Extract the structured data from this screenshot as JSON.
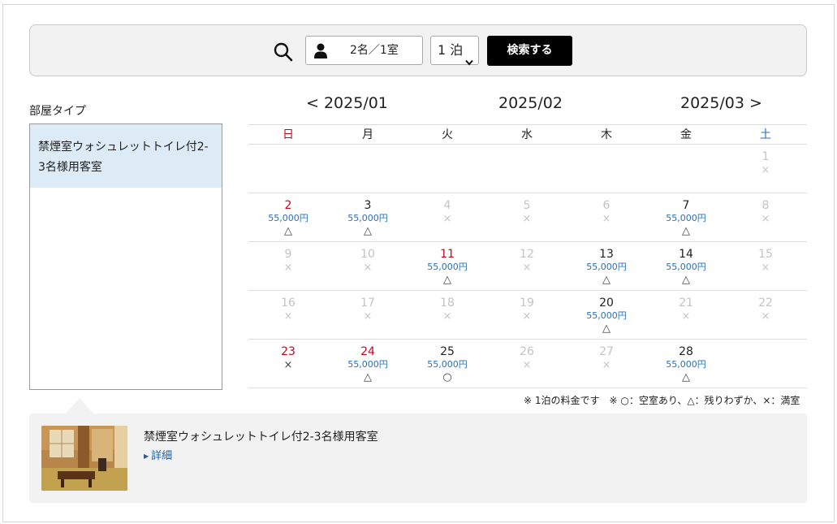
{
  "search": {
    "guests": "2名／1室",
    "nights": "1 泊",
    "button_label": "検索する"
  },
  "room_type": {
    "label": "部屋タイプ",
    "items": [
      {
        "name": "禁煙室ウォシュレットトイレ付2-3名様用客室"
      }
    ]
  },
  "calendar": {
    "prev_month": "< 2025/01",
    "current_month": "2025/02",
    "next_month": "2025/03 >",
    "weekdays": [
      "日",
      "月",
      "火",
      "水",
      "木",
      "金",
      "土"
    ],
    "weeks": [
      [
        {
          "day": "",
          "price": "",
          "status": ""
        },
        {
          "day": "",
          "price": "",
          "status": ""
        },
        {
          "day": "",
          "price": "",
          "status": ""
        },
        {
          "day": "",
          "price": "",
          "status": ""
        },
        {
          "day": "",
          "price": "",
          "status": ""
        },
        {
          "day": "",
          "price": "",
          "status": ""
        },
        {
          "day": "1",
          "price": "",
          "status": "×",
          "na": true
        }
      ],
      [
        {
          "day": "2",
          "price": "55,000円",
          "status": "△",
          "holiday": true
        },
        {
          "day": "3",
          "price": "55,000円",
          "status": "△"
        },
        {
          "day": "4",
          "price": "",
          "status": "×",
          "na": true
        },
        {
          "day": "5",
          "price": "",
          "status": "×",
          "na": true
        },
        {
          "day": "6",
          "price": "",
          "status": "×",
          "na": true
        },
        {
          "day": "7",
          "price": "55,000円",
          "status": "△"
        },
        {
          "day": "8",
          "price": "",
          "status": "×",
          "na": true
        }
      ],
      [
        {
          "day": "9",
          "price": "",
          "status": "×",
          "na": true
        },
        {
          "day": "10",
          "price": "",
          "status": "×",
          "na": true
        },
        {
          "day": "11",
          "price": "55,000円",
          "status": "△",
          "holiday": true
        },
        {
          "day": "12",
          "price": "",
          "status": "×",
          "na": true
        },
        {
          "day": "13",
          "price": "55,000円",
          "status": "△"
        },
        {
          "day": "14",
          "price": "55,000円",
          "status": "△"
        },
        {
          "day": "15",
          "price": "",
          "status": "×",
          "na": true
        }
      ],
      [
        {
          "day": "16",
          "price": "",
          "status": "×",
          "na": true
        },
        {
          "day": "17",
          "price": "",
          "status": "×",
          "na": true
        },
        {
          "day": "18",
          "price": "",
          "status": "×",
          "na": true
        },
        {
          "day": "19",
          "price": "",
          "status": "×",
          "na": true
        },
        {
          "day": "20",
          "price": "55,000円",
          "status": "△"
        },
        {
          "day": "21",
          "price": "",
          "status": "×",
          "na": true
        },
        {
          "day": "22",
          "price": "",
          "status": "×",
          "na": true
        }
      ],
      [
        {
          "day": "23",
          "price": "",
          "status": "×",
          "holiday": true
        },
        {
          "day": "24",
          "price": "55,000円",
          "status": "△",
          "holiday": true
        },
        {
          "day": "25",
          "price": "55,000円",
          "status": "○"
        },
        {
          "day": "26",
          "price": "",
          "status": "×",
          "na": true
        },
        {
          "day": "27",
          "price": "",
          "status": "×",
          "na": true
        },
        {
          "day": "28",
          "price": "55,000円",
          "status": "△"
        },
        {
          "day": "",
          "price": "",
          "status": ""
        }
      ]
    ],
    "legend": "※ 1泊の料金です　※ ○：空室あり、△：残りわずか、×：満室"
  },
  "detail": {
    "title": "禁煙室ウォシュレットトイレ付2-3名様用客室",
    "link": "詳細"
  },
  "colors": {
    "holiday": "#d0021b",
    "saturday": "#2a6fbf",
    "price": "#2a6fbf",
    "selected_room": "#dcebf6",
    "button": "#000000"
  },
  "icons": [
    "search-icon",
    "person-icon",
    "chevron-down-icon",
    "triangle-right-icon"
  ]
}
